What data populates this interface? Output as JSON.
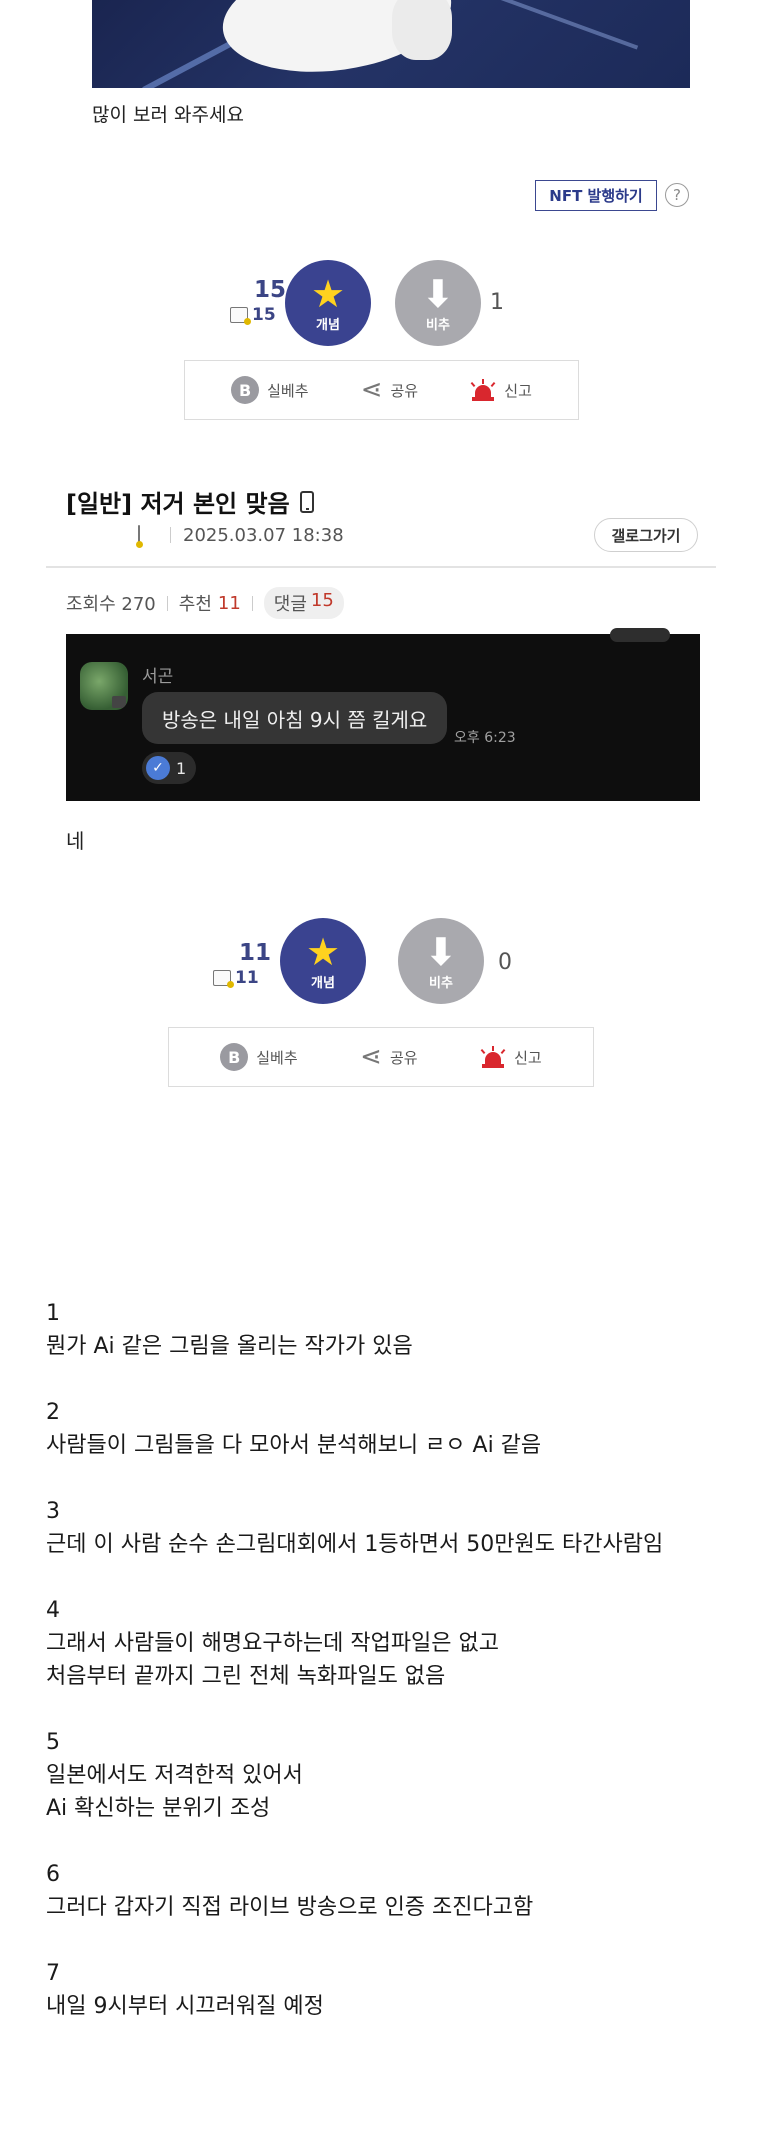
{
  "top_image": {
    "caption": "많이 보러 와주세요"
  },
  "nft": {
    "label": "NFT 발행하기",
    "help": "?"
  },
  "vote1": {
    "up_count": "15",
    "up_sub_count": "15",
    "up_label": "개념",
    "down_label": "비추",
    "down_count": "1"
  },
  "actions": {
    "bestrec": "실베추",
    "share": "공유",
    "report": "신고",
    "b_glyph": "B"
  },
  "post": {
    "title": "[일반] 저거 본인 맞음",
    "date": "2025.03.07 18:38",
    "gallery_button": "갤로그가기",
    "views_label": "조회수 270",
    "rec_label": "추천",
    "rec_value": "11",
    "comment_label": "댓글",
    "comment_value": "15",
    "body": "네"
  },
  "chat": {
    "name": "서곤",
    "message": "방송은 내일 아침 9시 쯤 킬게요",
    "time": "오후 6:23",
    "reaction_count": "1"
  },
  "vote2": {
    "up_count": "11",
    "up_sub_count": "11",
    "up_label": "개념",
    "down_label": "비추",
    "down_count": "0"
  },
  "article": {
    "paragraphs": [
      {
        "num": "1",
        "lines": [
          "뭔가 Ai 같은 그림을 올리는 작가가 있음"
        ]
      },
      {
        "num": "2",
        "lines": [
          "사람들이 그림들을 다 모아서 분석해보니 ㄹㅇ Ai 같음"
        ]
      },
      {
        "num": "3",
        "lines": [
          "근데 이 사람 순수 손그림대회에서 1등하면서 50만원도 타간사람임"
        ]
      },
      {
        "num": "4",
        "lines": [
          "그래서 사람들이 해명요구하는데 작업파일은 없고",
          "처음부터 끝까지 그린 전체 녹화파일도 없음"
        ]
      },
      {
        "num": "5",
        "lines": [
          "일본에서도 저격한적 있어서",
          "Ai 확신하는 분위기 조성"
        ]
      },
      {
        "num": "6",
        "lines": [
          "그러다 갑자기 직접 라이브 방송으로 인증 조진다고함"
        ]
      },
      {
        "num": "7",
        "lines": [
          "내일 9시부터 시끄러워질 예정"
        ]
      }
    ]
  }
}
